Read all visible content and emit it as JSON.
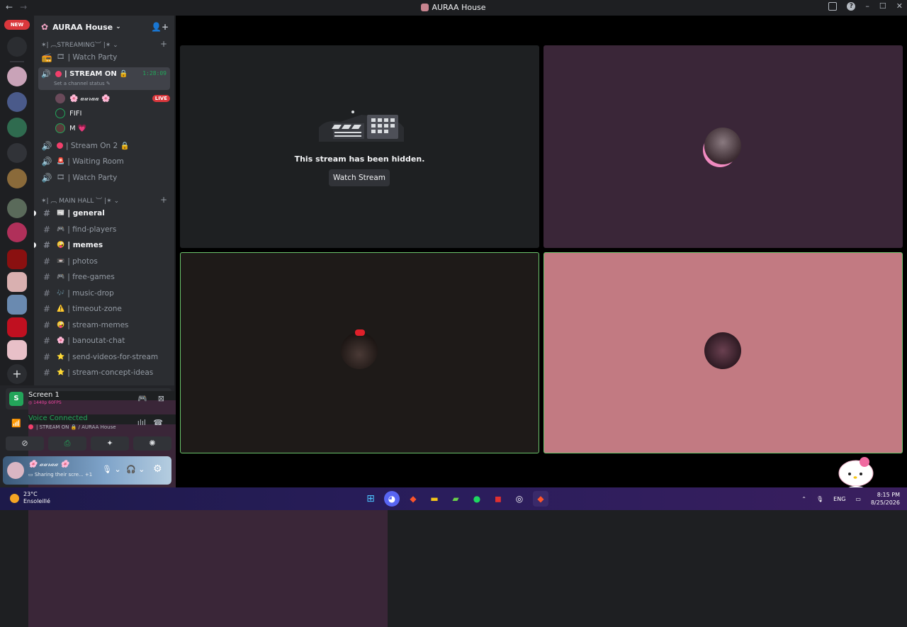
{
  "window": {
    "title": "AURAA House",
    "back": "←",
    "forward": "→",
    "min": "–",
    "max": "☐",
    "close": "✕"
  },
  "guilds": {
    "new_label": "NEW",
    "add": "+"
  },
  "server": {
    "name": "AURAA House",
    "chev": "⌄",
    "invite": "👤+"
  },
  "categories": {
    "streaming": {
      "label": "✶| ︹STREAMING︺ |✶ ⌄",
      "plus": "+"
    },
    "main_hall": {
      "label": "✶| ︹ MAIN HALL ︺ |✶ ⌄",
      "plus": "+"
    }
  },
  "voice_channels": [
    {
      "icon": "📻",
      "emoji": "🎞",
      "name": "| Watch Party"
    },
    {
      "icon": "🔊",
      "name": "| STREAM ON 🔒",
      "timer": "1:28:09",
      "status": "Set a channel status ✎"
    },
    {
      "icon": "🔊",
      "name": "| Stream On 2 🔒"
    },
    {
      "icon": "🔊",
      "emoji": "🚨",
      "name": "| Waiting Room"
    },
    {
      "icon": "🔊",
      "emoji": "🎞",
      "name": "| Watch Party"
    }
  ],
  "voice_users": [
    {
      "name": "🌸 𝒶𝓊𝓇𝒶𝒶 🌸",
      "badge": "LIVE"
    },
    {
      "name": "FIFI"
    },
    {
      "name": "M 💗"
    }
  ],
  "text_channels": [
    {
      "emoji": "📰",
      "name": "| general",
      "bold": true
    },
    {
      "emoji": "🎮",
      "name": "| find-players"
    },
    {
      "emoji": "🤪",
      "name": "| memes",
      "bold": true
    },
    {
      "emoji": "📼",
      "name": "| photos"
    },
    {
      "emoji": "🎮",
      "name": "| free-games"
    },
    {
      "emoji": "🎶",
      "name": "| music-drop"
    },
    {
      "emoji": "⚠️",
      "name": "| timeout-zone"
    },
    {
      "emoji": "🤪",
      "name": "| stream-memes"
    },
    {
      "emoji": "🌸",
      "name": "| banoutat-chat"
    },
    {
      "emoji": "⭐",
      "name": "| send-videos-for-stream"
    },
    {
      "emoji": "⭐",
      "name": "| stream-concept-ideas"
    }
  ],
  "screen_share": {
    "title": "Screen 1",
    "quality": "◎ 1440p 60FPS",
    "icon_letter": "S"
  },
  "voice_status": {
    "title": "Voice Connected",
    "detail": "| STREAM ON 🔒 / AURAA House"
  },
  "controls": [
    "⊘",
    "⎙",
    "✦",
    "✺"
  ],
  "user": {
    "name": "🌸 𝒶𝓊𝓇𝒶𝒶 🌸",
    "status": "▭ Sharing their scre... +1"
  },
  "stream": {
    "hidden_text": "This stream has been hidden.",
    "watch_label": "Watch Stream"
  },
  "taskbar": {
    "temp": "23°C",
    "weather": "Ensoleillé",
    "lang": "ENG",
    "time": "8:15 PM",
    "date": "8/25/2026"
  },
  "colors": {
    "accent_green": "#23a55a",
    "live_red": "#da373c",
    "tile_pink": "#c27a82"
  }
}
